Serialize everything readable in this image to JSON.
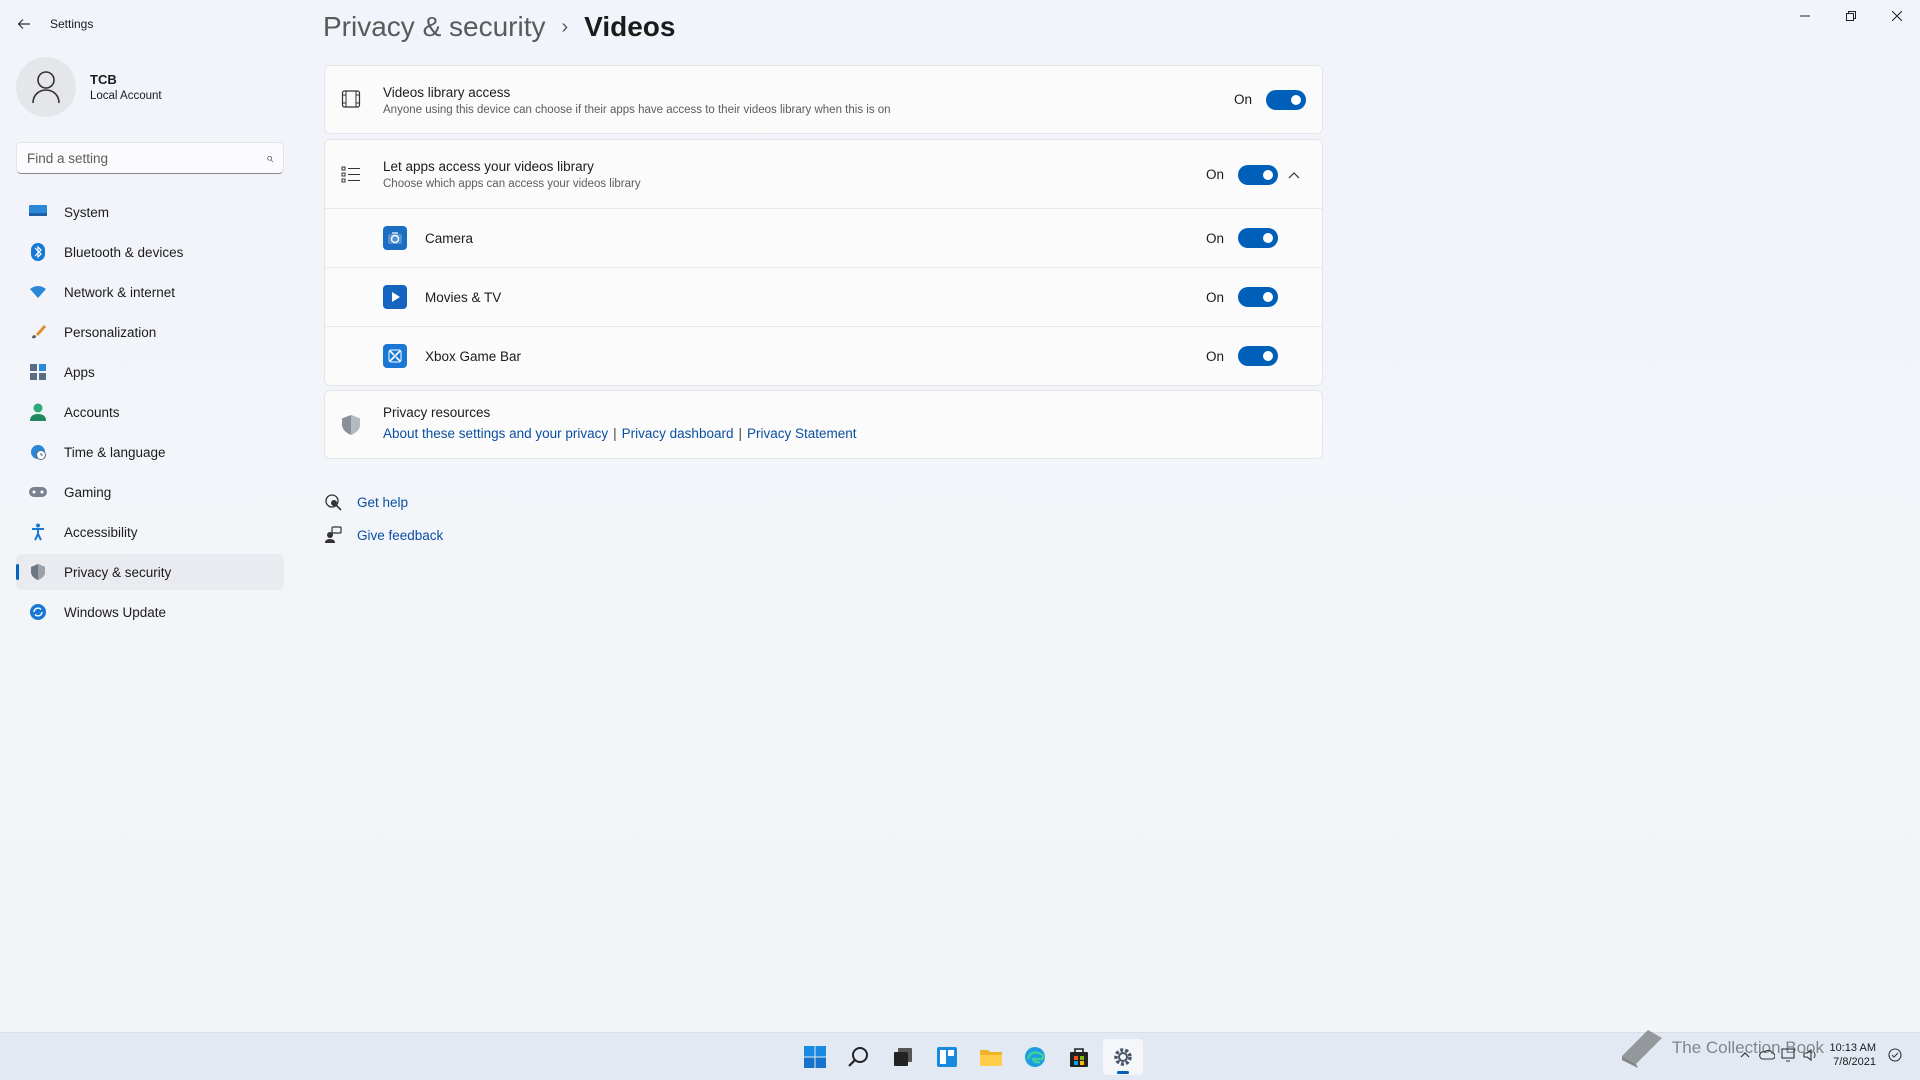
{
  "window": {
    "title": "Settings",
    "controls": [
      "minimize",
      "restore",
      "close"
    ]
  },
  "profile": {
    "name": "TCB",
    "account_type": "Local Account"
  },
  "search": {
    "placeholder": "Find a setting"
  },
  "sidebar": {
    "items": [
      {
        "label": "System",
        "icon": "monitor-icon"
      },
      {
        "label": "Bluetooth & devices",
        "icon": "bluetooth-icon"
      },
      {
        "label": "Network & internet",
        "icon": "wifi-icon"
      },
      {
        "label": "Personalization",
        "icon": "brush-icon"
      },
      {
        "label": "Apps",
        "icon": "apps-icon"
      },
      {
        "label": "Accounts",
        "icon": "person-icon"
      },
      {
        "label": "Time & language",
        "icon": "globe-clock-icon"
      },
      {
        "label": "Gaming",
        "icon": "gamepad-icon"
      },
      {
        "label": "Accessibility",
        "icon": "accessibility-icon"
      },
      {
        "label": "Privacy & security",
        "icon": "shield-icon",
        "active": true
      },
      {
        "label": "Windows Update",
        "icon": "update-icon"
      }
    ]
  },
  "breadcrumb": {
    "parent": "Privacy & security",
    "separator": "›",
    "current": "Videos"
  },
  "settings": {
    "library_access": {
      "title": "Videos library access",
      "description": "Anyone using this device can choose if their apps have access to their videos library when this is on",
      "state": "On"
    },
    "let_apps": {
      "title": "Let apps access your videos library",
      "description": "Choose which apps can access your videos library",
      "state": "On"
    },
    "apps": [
      {
        "name": "Camera",
        "state": "On",
        "icon": "camera-app-icon"
      },
      {
        "name": "Movies & TV",
        "state": "On",
        "icon": "movies-tv-app-icon"
      },
      {
        "name": "Xbox Game Bar",
        "state": "On",
        "icon": "xbox-game-bar-app-icon"
      }
    ]
  },
  "privacy_resources": {
    "title": "Privacy resources",
    "links": [
      "About these settings and your privacy",
      "Privacy dashboard",
      "Privacy Statement"
    ],
    "separator": "|"
  },
  "help": {
    "get_help": "Get help",
    "give_feedback": "Give feedback"
  },
  "taskbar": {
    "icons": [
      "start-icon",
      "search-icon",
      "task-view-icon",
      "widgets-icon",
      "file-explorer-icon",
      "edge-icon",
      "store-icon",
      "settings-icon"
    ],
    "active": "settings-icon",
    "clock": {
      "time": "10:13 AM",
      "date": "7/8/2021"
    }
  },
  "watermark": "The Collection Book",
  "colors": {
    "accent": "#005fb8",
    "link": "#0a4fa0",
    "background": "#f3f5f9"
  }
}
